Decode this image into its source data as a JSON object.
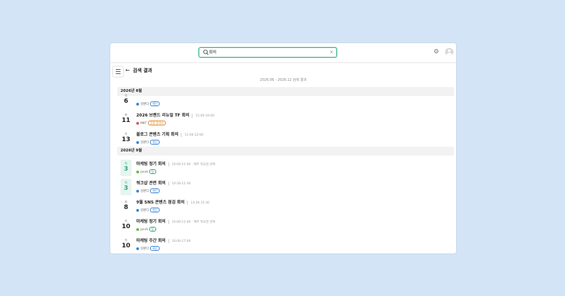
{
  "search": {
    "value": "회의",
    "clear_symbol": "×"
  },
  "header": {
    "back_arrow": "←",
    "title": "검색 결과",
    "range_text": "2026.06 - 2026.12 검색 결과"
  },
  "icons": {
    "search": "search-icon",
    "clear": "close-icon",
    "settings": "gear-icon",
    "avatar": "user-avatar-icon",
    "sidebar": "list-menu-icon",
    "back": "arrow-left-icon"
  },
  "colors": {
    "accent": "#34b08a",
    "blue_dot": "#3b82d6",
    "red_dot": "#e05353",
    "green_dot": "#62b94a",
    "background": "#d3e4f7"
  },
  "months": [
    {
      "label": "2026년 8월"
    },
    {
      "label": "2026년 9월"
    }
  ],
  "events": [
    {
      "dow": "목",
      "day": "6",
      "title": "",
      "time": "",
      "owner": "김판다",
      "tag": "개인",
      "today": false
    },
    {
      "dow": "화",
      "day": "11",
      "title": "2026 브랜드 리뉴얼 TF 회의",
      "time": "15:00-16:00",
      "owner": "MKT",
      "tag": "준정 참여자",
      "today": false
    },
    {
      "dow": "목",
      "day": "13",
      "title": "블로그 콘텐츠 기획 회의",
      "time": "11:00-12:00",
      "owner": "김판다",
      "tag": "개인",
      "today": false
    },
    {
      "dow": "목",
      "day": "3",
      "title": "마케팅 정기 회의",
      "time": "10:00-11:00 · 매주 목요일 반복",
      "owner": "jandi",
      "tag": "팀",
      "today": true
    },
    {
      "dow": "목",
      "day": "3",
      "title": "워크샵 관련 회의",
      "time": "10:30-11:30",
      "owner": "김판다",
      "tag": "개인",
      "today": true
    },
    {
      "dow": "화",
      "day": "8",
      "title": "9월 SNS 콘텐츠 점검 회의",
      "time": "14:30-15:30",
      "owner": "김판다",
      "tag": "개인",
      "today": false
    },
    {
      "dow": "목",
      "day": "10",
      "title": "마케팅 정기 회의",
      "time": "10:00-11:00 · 매주 목요일 반복",
      "owner": "jandi",
      "tag": "팀",
      "today": false
    },
    {
      "dow": "목",
      "day": "10",
      "title": "마케팅 주간 회의",
      "time": "16:00-17:00",
      "owner": "김판다",
      "tag": "개인",
      "today": false
    }
  ]
}
